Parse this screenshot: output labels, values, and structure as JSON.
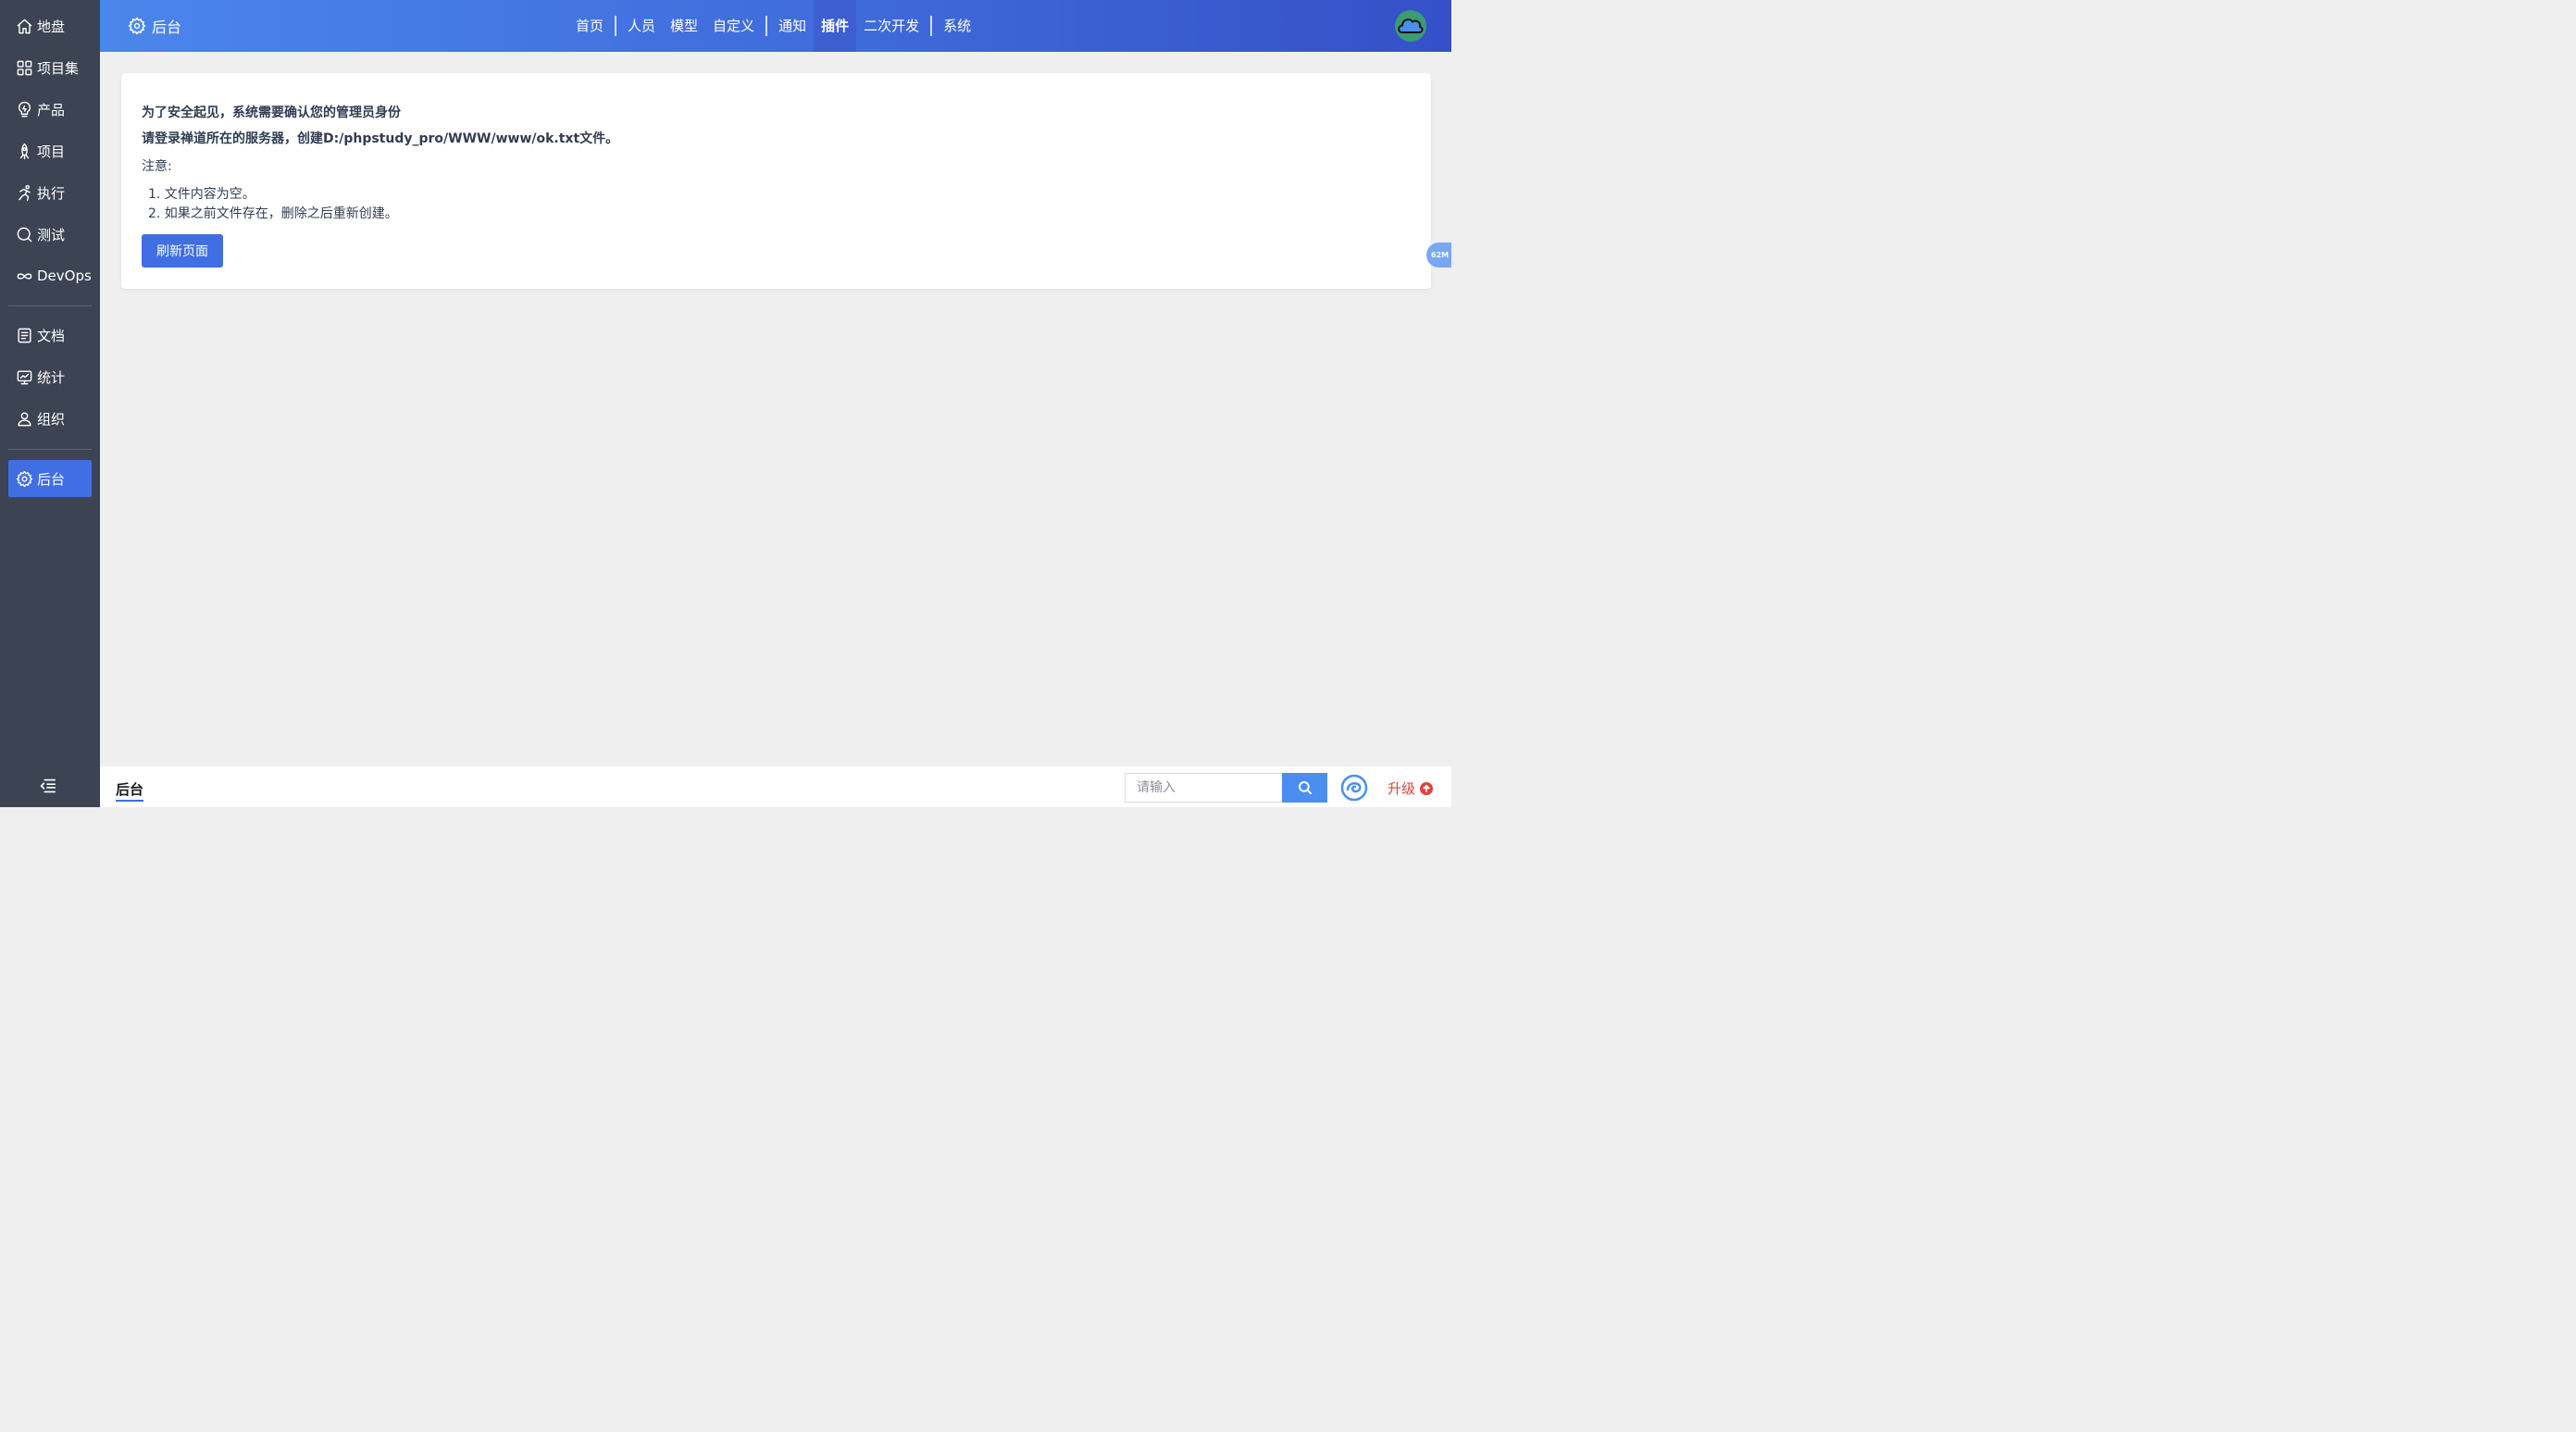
{
  "sidebar": {
    "items": [
      {
        "label": "地盘",
        "icon": "home-icon"
      },
      {
        "label": "项目集",
        "icon": "grid-icon"
      },
      {
        "label": "产品",
        "icon": "lightbulb-icon"
      },
      {
        "label": "项目",
        "icon": "rocket-icon"
      },
      {
        "label": "执行",
        "icon": "run-icon"
      },
      {
        "label": "测试",
        "icon": "search-circle-icon"
      },
      {
        "label": "DevOps",
        "icon": "infinity-icon"
      },
      {
        "label": "文档",
        "icon": "document-icon"
      },
      {
        "label": "统计",
        "icon": "monitor-icon"
      },
      {
        "label": "组织",
        "icon": "user-icon"
      },
      {
        "label": "后台",
        "icon": "gear-icon",
        "active": true
      }
    ]
  },
  "header": {
    "title": "后台",
    "nav": [
      {
        "label": "首页"
      },
      {
        "label": "人员"
      },
      {
        "label": "模型"
      },
      {
        "label": "自定义"
      },
      {
        "label": "通知"
      },
      {
        "label": "插件",
        "active": true
      },
      {
        "label": "二次开发"
      },
      {
        "label": "系统"
      }
    ]
  },
  "panel": {
    "line1": "为了安全起见，系统需要确认您的管理员身份",
    "line2": "请登录禅道所在的服务器，创建D:/phpstudy_pro/WWW/www/ok.txt文件。",
    "note": "注意:",
    "items": [
      "1. 文件内容为空。",
      "2. 如果之前文件存在，删除之后重新创建。"
    ],
    "refresh_label": "刷新页面"
  },
  "memory_badge": "62M",
  "footer": {
    "breadcrumb": "后台",
    "search_placeholder": "请输入",
    "upgrade_label": "升级"
  },
  "colors": {
    "sidebar_bg": "#3c4353",
    "accent": "#3f6fe2",
    "header_gradient_start": "#4b86eb",
    "header_gradient_end": "#3550c8",
    "upgrade_red": "#e0413f"
  }
}
